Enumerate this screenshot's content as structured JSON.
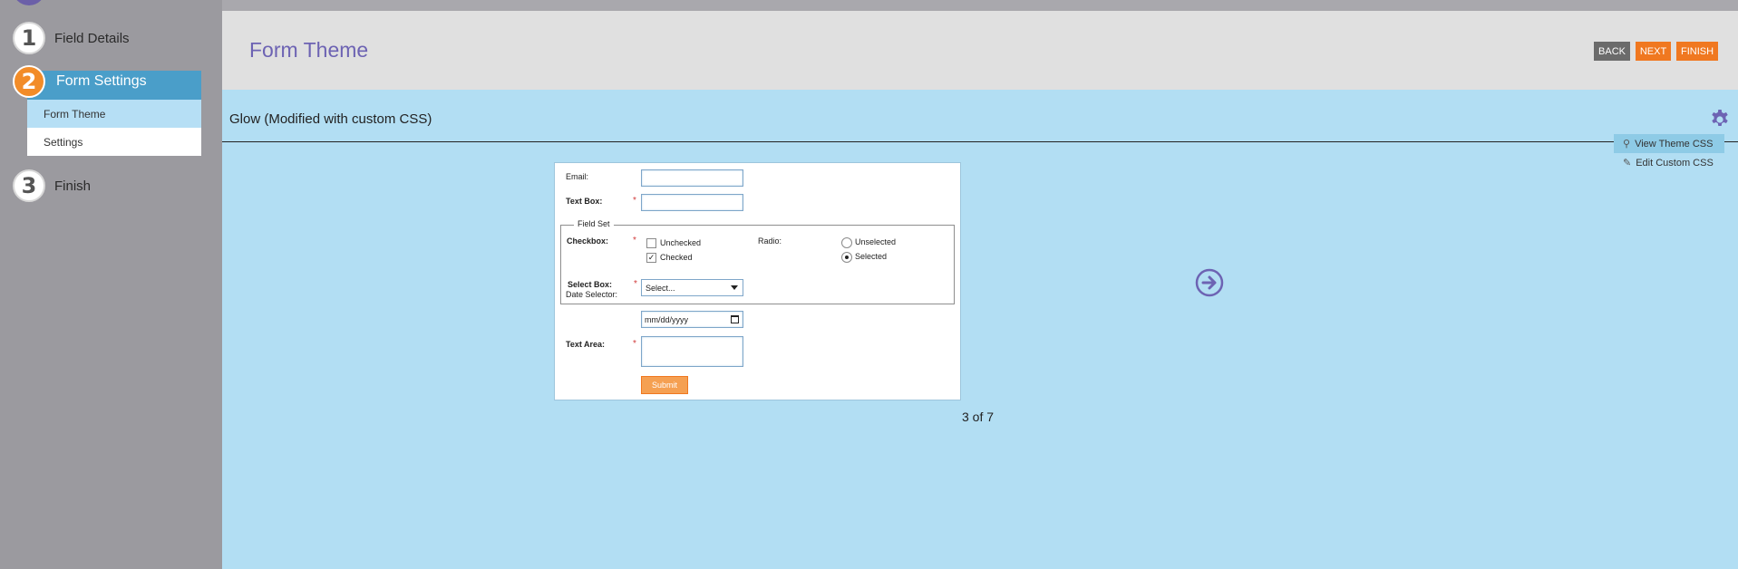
{
  "sidebar": {
    "steps": [
      {
        "num": "1",
        "label": "Field Details"
      },
      {
        "num": "2",
        "label": "Form Settings"
      },
      {
        "num": "3",
        "label": "Finish"
      }
    ],
    "sub_items": [
      "Form Theme",
      "Settings"
    ]
  },
  "header": {
    "title": "Form Theme",
    "back_label": "BACK",
    "next_label": "NEXT",
    "finish_label": "FINISH"
  },
  "theme": {
    "name": "Glow (Modified with custom CSS)",
    "menu": {
      "view_label": "View Theme CSS",
      "edit_label": "Edit Custom CSS"
    }
  },
  "preview": {
    "email_label": "Email:",
    "textbox_label": "Text Box:",
    "fieldset_legend": "Field Set",
    "checkbox_label": "Checkbox:",
    "checkbox_options": [
      {
        "label": "Unchecked",
        "checked": false
      },
      {
        "label": "Checked",
        "checked": true
      }
    ],
    "radio_label": "Radio:",
    "radio_options": [
      {
        "label": "Unselected",
        "selected": false
      },
      {
        "label": "Selected",
        "selected": true
      }
    ],
    "selectbox_label": "Select Box:",
    "selectbox_value": "Select...",
    "date_label": "Date Selector:",
    "date_placeholder": "mm/dd/yyyy",
    "textarea_label": "Text Area:",
    "required_mark": "*",
    "submit_label": "Submit"
  },
  "pager": {
    "text": "3 of 7"
  },
  "colors": {
    "accent_orange": "#f07820",
    "header_title": "#6d63b3",
    "main_bg": "#b2def3",
    "sidebar_active": "#4a9ec9",
    "sidebar_bg": "#9b9a9f"
  },
  "icons": {
    "gear": "gear-icon",
    "prev": "arrow-left-circle-icon",
    "next": "arrow-right-circle-icon",
    "view": "magnifier-icon",
    "edit": "pencil-icon"
  }
}
